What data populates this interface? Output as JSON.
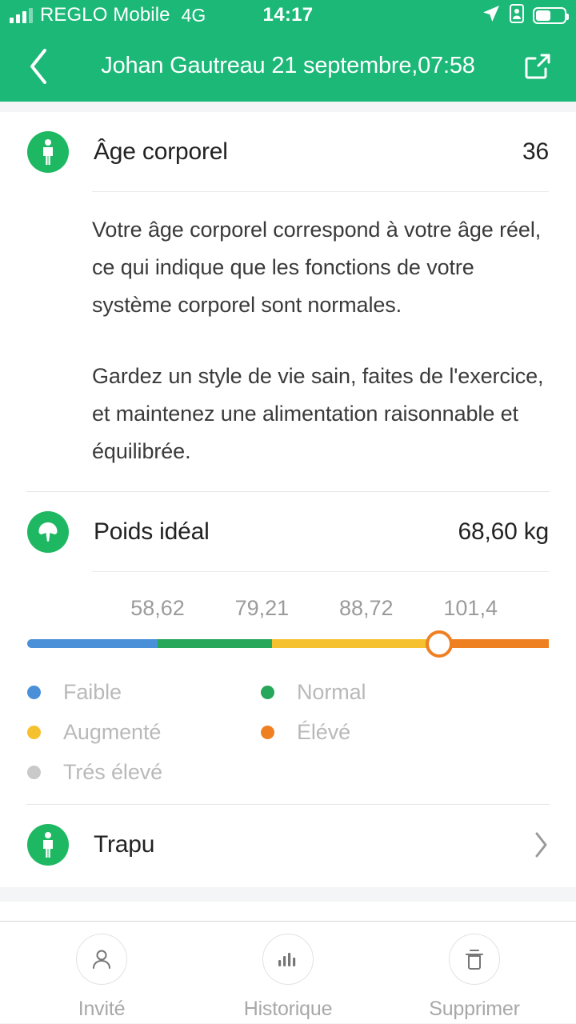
{
  "statusbar": {
    "carrier": "REGLO Mobile",
    "network": "4G",
    "time": "14:17",
    "signal_icon": "signal-bars-icon",
    "location_icon": "location-arrow-icon",
    "badge_icon": "id-badge-icon",
    "battery_icon": "battery-icon"
  },
  "navbar": {
    "back_icon": "chevron-left-icon",
    "title": "Johan Gautreau 21 septembre,07:58",
    "share_icon": "share-external-icon"
  },
  "body_age": {
    "icon": "person-standing-icon",
    "label": "Âge corporel",
    "value": "36",
    "paragraphs": [
      "Votre âge corporel correspond à votre âge réel, ce qui indique que les fonctions de votre système corporel sont normales.",
      "Gardez un style de vie sain, faites de l'exercice, et maintenez une alimentation raisonnable et équilibrée."
    ]
  },
  "ideal_weight": {
    "icon": "arrow-up-circle-icon",
    "label": "Poids idéal",
    "value": "68,60 kg"
  },
  "body_type": {
    "icon": "person-standing-icon",
    "label": "Trapu",
    "chevron_icon": "chevron-right-icon"
  },
  "toolbar": {
    "items": [
      {
        "label": "Invité",
        "icon": "person-outline-icon"
      },
      {
        "label": "Historique",
        "icon": "bar-chart-icon"
      },
      {
        "label": "Supprimer",
        "icon": "trash-icon"
      }
    ]
  },
  "colors": {
    "brand_green": "#1bb878",
    "badge_green": "#1fb862",
    "low": "#4a90d9",
    "normal": "#26a75a",
    "increased": "#f5c12e",
    "high": "#ef8022",
    "very_high": "#c9c9c9"
  },
  "chart_data": {
    "type": "bar",
    "title": "Poids idéal",
    "xlabel": "",
    "ylabel": "",
    "orientation": "horizontal-scale",
    "tick_labels": [
      "58,62",
      "79,21",
      "88,72",
      "101,4"
    ],
    "tick_values": [
      58.62,
      79.21,
      88.72,
      101.4
    ],
    "tick_positions_pct": [
      25,
      45,
      65,
      85
    ],
    "current_value": 101.4,
    "current_unit": "kg",
    "marker_position_pct": 79,
    "segments": [
      {
        "name": "Faible",
        "color": "#4a90d9",
        "width_pct": 25
      },
      {
        "name": "Normal",
        "color": "#26a75a",
        "width_pct": 22
      },
      {
        "name": "Augmenté",
        "color": "#f5c12e",
        "width_pct": 32
      },
      {
        "name": "Élevé",
        "color": "#ef8022",
        "width_pct": 21
      }
    ],
    "legend_position": "below",
    "legend": [
      {
        "label": "Faible",
        "color": "#4a90d9"
      },
      {
        "label": "Normal",
        "color": "#26a75a"
      },
      {
        "label": "Augmenté",
        "color": "#f5c12e"
      },
      {
        "label": "Élévé",
        "color": "#ef8022"
      },
      {
        "label": "Trés élevé",
        "color": "#c9c9c9"
      }
    ],
    "grid": false
  }
}
